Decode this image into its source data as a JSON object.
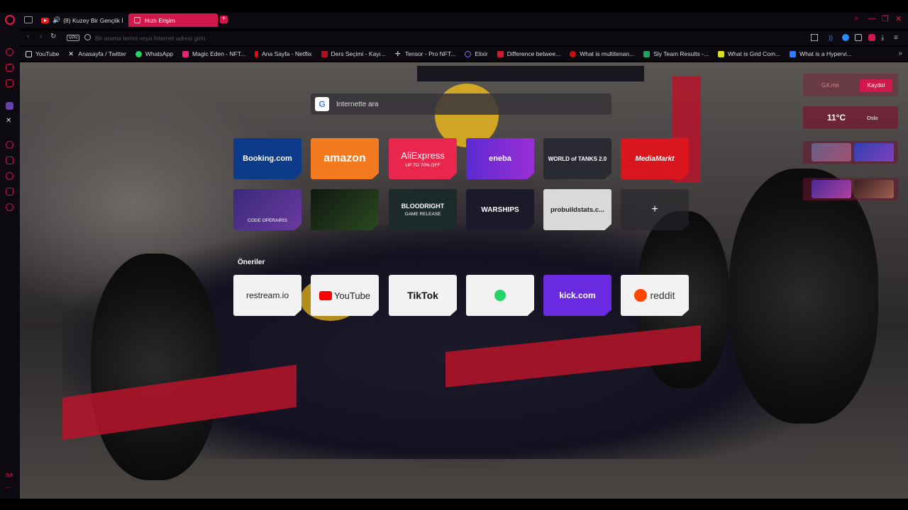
{
  "tabs": [
    {
      "title": "(8) Kuzey Bir Gençlik İ",
      "active": false,
      "favicon": "youtube-icon"
    },
    {
      "title": "Hızlı Erişim",
      "active": true,
      "favicon": "speed-dial-icon"
    }
  ],
  "address_bar": {
    "vpn_label": "VPN",
    "placeholder": "Bir arama terimi veya İnternet adresi girin"
  },
  "bookmarks": [
    {
      "label": "YouTube",
      "icon": "page-icon",
      "color": "#dddddd"
    },
    {
      "label": "Anasayfa / Twitter",
      "icon": "x-icon",
      "color": "#ffffff"
    },
    {
      "label": "WhatsApp",
      "icon": "whatsapp-icon",
      "color": "#25d366"
    },
    {
      "label": "Magic Eden - NFT...",
      "icon": "magic-eden-icon",
      "color": "#e42575"
    },
    {
      "label": "Ana Sayfa - Netflix",
      "icon": "netflix-icon",
      "color": "#e50914"
    },
    {
      "label": "Ders Seçimi - Kayı...",
      "icon": "school-icon",
      "color": "#b01020"
    },
    {
      "label": "Tensor - Pro NFT...",
      "icon": "tensor-icon",
      "color": "#ffffff"
    },
    {
      "label": "Elixir",
      "icon": "elixir-icon",
      "color": "#8a6cff"
    },
    {
      "label": "Difference betwee...",
      "icon": "site-icon",
      "color": "#d0192a"
    },
    {
      "label": "What is multitenan...",
      "icon": "site-icon",
      "color": "#c81010"
    },
    {
      "label": "Sly Team Results -...",
      "icon": "sheets-icon",
      "color": "#1fa463"
    },
    {
      "label": "What is Grid Com...",
      "icon": "site-icon",
      "color": "#d9e021"
    },
    {
      "label": "What is a Hypervi...",
      "icon": "site-icon",
      "color": "#2a7fff"
    }
  ],
  "search": {
    "placeholder": "İnternette ara"
  },
  "speed_dial": [
    {
      "label": "Booking.com",
      "bg": "#0c3b8a",
      "sub": ""
    },
    {
      "label": "amazon",
      "bg": "#f47a1f",
      "sub": ""
    },
    {
      "label": "AliExpress",
      "bg": "#e8264e",
      "sub": "UP TO 70% OFF"
    },
    {
      "label": "eneba",
      "bg": "#5b2bd0",
      "sub": ""
    },
    {
      "label": "WORLD of TANKS 2.0",
      "bg": "#2a2a33",
      "sub": ""
    },
    {
      "label": "MediaMarkt",
      "bg": "#d9161d",
      "sub": ""
    },
    {
      "label": "",
      "bg": "#3a2a7a",
      "sub": "CODE OPERAIRIS"
    },
    {
      "label": "",
      "bg": "#101810",
      "sub": ""
    },
    {
      "label": "BLOODRIGHT",
      "bg": "#1c2a2a",
      "sub": "GAME RELEASE"
    },
    {
      "label": "WARSHIPS",
      "bg": "#1a1a2a",
      "sub": ""
    },
    {
      "label": "probuildstats.c...",
      "bg": "#d9d9d9",
      "sub": ""
    },
    {
      "label": "+",
      "bg": "rgba(40,38,45,0.6)",
      "sub": ""
    }
  ],
  "suggestions_label": "Öneriler",
  "suggestions": [
    {
      "label": "restream.io",
      "bg": "#f2f2f2",
      "fg": "#222222"
    },
    {
      "label": "YouTube",
      "bg": "#f2f2f2",
      "fg": "#222222"
    },
    {
      "label": "TikTok",
      "bg": "#f2f2f2",
      "fg": "#111111"
    },
    {
      "label": "",
      "bg": "#f2f2f2",
      "fg": "#25d366"
    },
    {
      "label": "kick.com",
      "bg": "#6a2be0",
      "fg": "#ffffff"
    },
    {
      "label": "reddit",
      "bg": "#f2f2f2",
      "fg": "#333333"
    }
  ],
  "widgets": {
    "gxme_label": "GX.me",
    "signup_label": "Kaydol",
    "temperature": "11°C",
    "city": "Oslo"
  },
  "sidebar_bottom": {
    "gx_label": "GX",
    "more": "···"
  },
  "colors": {
    "accent": "#d0194a"
  }
}
